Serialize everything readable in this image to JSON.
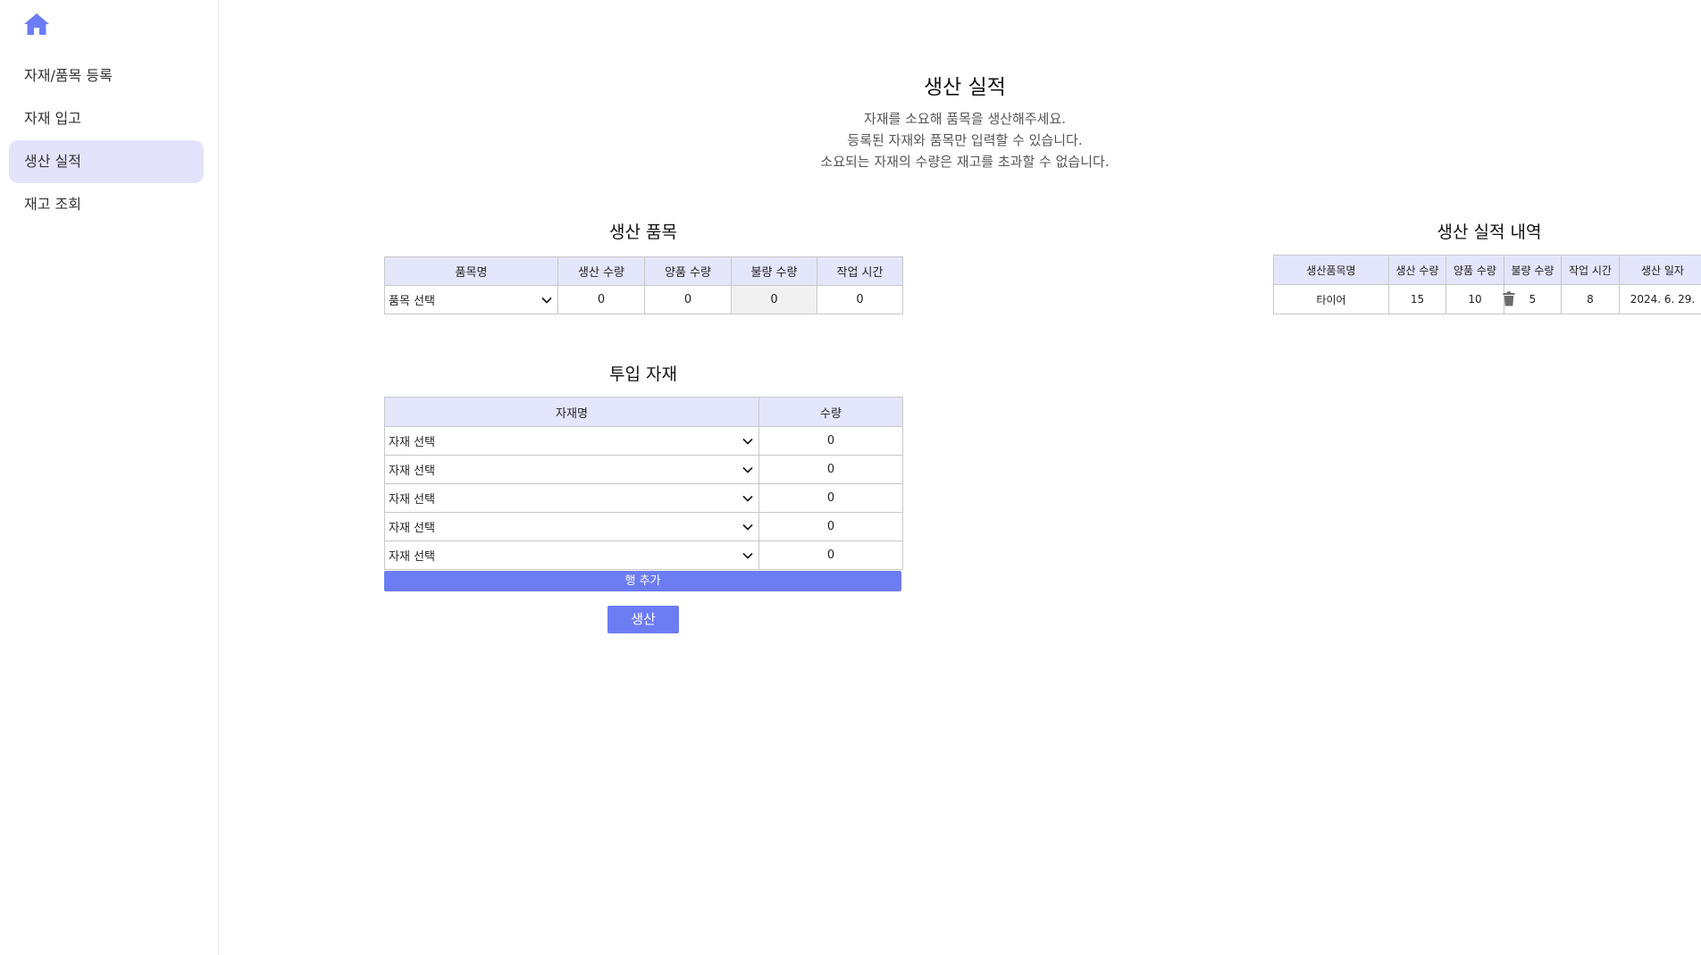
{
  "colors": {
    "accent": "#6c7cf3",
    "header_bg": "#e4e6fb",
    "nav_active_bg": "#e3e4fb"
  },
  "sidebar": {
    "home_icon": "home-icon",
    "items": [
      {
        "label": "자재/품목 등록",
        "active": false
      },
      {
        "label": "자재 입고",
        "active": false
      },
      {
        "label": "생산 실적",
        "active": true
      },
      {
        "label": "재고 조회",
        "active": false
      }
    ]
  },
  "page": {
    "title": "생산 실적",
    "desc": [
      "자재를 소요해 품목을 생산해주세요.",
      "등록된 자재와 품목만 입력할 수 있습니다.",
      "소요되는 자재의 수량은 재고를 초과할 수 없습니다."
    ]
  },
  "product": {
    "title": "생산 품목",
    "headers": [
      "품목명",
      "생산 수량",
      "양품 수량",
      "불량 수량",
      "작업 시간"
    ],
    "row": {
      "select": "품목 선택",
      "produced": "0",
      "good": "0",
      "defect": "0",
      "work_time": "0"
    }
  },
  "materials": {
    "title": "투입 자재",
    "headers": [
      "자재명",
      "수량"
    ],
    "rows": [
      {
        "select": "자재 선택",
        "qty": "0"
      },
      {
        "select": "자재 선택",
        "qty": "0"
      },
      {
        "select": "자재 선택",
        "qty": "0"
      },
      {
        "select": "자재 선택",
        "qty": "0"
      },
      {
        "select": "자재 선택",
        "qty": "0"
      }
    ],
    "add_row_label": "행 추가"
  },
  "produce_label": "생산",
  "history": {
    "title": "생산 실적 내역",
    "headers": [
      "생산품목명",
      "생산 수량",
      "양품 수량",
      "불량 수량",
      "작업 시간",
      "생산 일자"
    ],
    "rows": [
      {
        "name": "타이어",
        "produced": "15",
        "good": "10",
        "defect": "5",
        "work_time": "8",
        "date": "2024. 6. 29."
      }
    ]
  }
}
